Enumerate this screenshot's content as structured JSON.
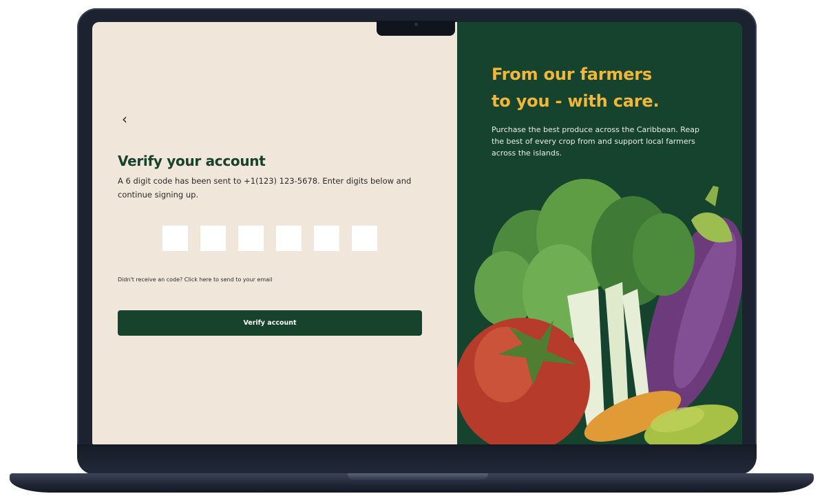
{
  "auth": {
    "back_icon": "‹",
    "title": "Verify your account",
    "description": "A 6 digit code has been sent to +1(123) 123-5678. Enter digits below and continue signing up.",
    "code_digits": [
      "",
      "",
      "",
      "",
      "",
      ""
    ],
    "resend_text": "Didn't receive an code? Click here to send to your email",
    "verify_button": "Verify account"
  },
  "hero": {
    "title_line1": "From our farmers",
    "title_line2": "to you - with care.",
    "description": "Purchase the best produce across the Caribbean. Reap the best of every crop from and support local farmers across the islands."
  },
  "colors": {
    "left_background": "#f1e6da",
    "right_background": "#16432d",
    "accent_green": "#17432d",
    "headline_yellow": "#f0b73a"
  }
}
